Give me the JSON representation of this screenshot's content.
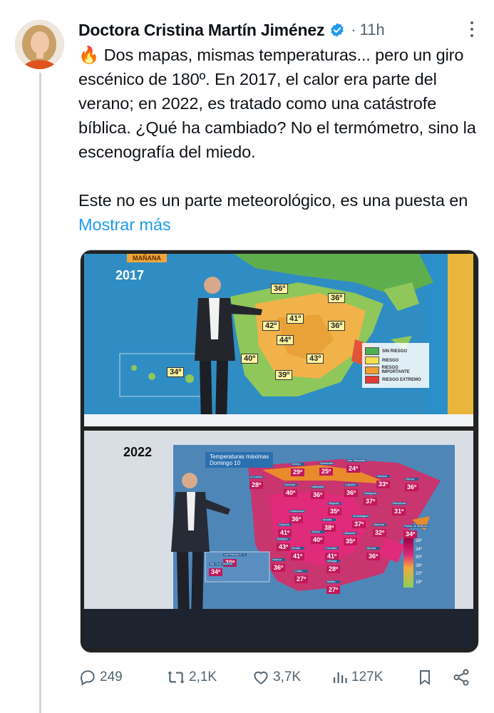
{
  "tweet": {
    "author_name": "Doctora Cristina Martín Jiménez",
    "separator": "·",
    "time": "11h",
    "emoji": "🔥",
    "text_paragraph_1": "Dos mapas, mismas temperaturas... pero un giro escénico de 180º. En 2017, el calor era parte del verano; en 2022, es tratado como una catástrofe bíblica. ¿Qué ha cambiado? No el termómetro, sino la escenografía del miedo.",
    "text_paragraph_2": "Este no es un parte meteorológico, es una puesta en",
    "show_more": "Mostrar más"
  },
  "media": {
    "top_panel": {
      "year": "2017",
      "corner_label": "MAÑANA",
      "temps": [
        "36º",
        "36º",
        "41º",
        "42º",
        "44º",
        "36º",
        "40º",
        "43º",
        "39º",
        "34º"
      ],
      "legend": [
        "SIN RIESGO",
        "RIESGO",
        "RIESGO IMPORTANTE",
        "RIESGO EXTREMO"
      ],
      "legend_colors": [
        "#4caf50",
        "#f4e04d",
        "#f0a030",
        "#e53935"
      ]
    },
    "bottom_panel": {
      "year": "2022",
      "title": "Temperaturas máximas",
      "subtitle": "Domingo 10",
      "cities": [
        {
          "name": "Oviedo",
          "temp": "29º"
        },
        {
          "name": "Santander",
          "temp": "25º"
        },
        {
          "name": "San Sebastián",
          "temp": "24º"
        },
        {
          "name": "A Coruña",
          "temp": "28º"
        },
        {
          "name": "Huesca",
          "temp": "33º"
        },
        {
          "name": "Girona",
          "temp": "36º"
        },
        {
          "name": "Ourense",
          "temp": "40º"
        },
        {
          "name": "Valladolid",
          "temp": "36º"
        },
        {
          "name": "Logroño",
          "temp": "36º"
        },
        {
          "name": "Zaragoza",
          "temp": "37º"
        },
        {
          "name": "Segovia",
          "temp": "35º"
        },
        {
          "name": "Barcelona",
          "temp": "31º"
        },
        {
          "name": "Salamanca",
          "temp": "36º"
        },
        {
          "name": "Madrid",
          "temp": "38º"
        },
        {
          "name": "Guadalajara",
          "temp": "37º"
        },
        {
          "name": "Cáceres",
          "temp": "41º"
        },
        {
          "name": "Valencia",
          "temp": "32º"
        },
        {
          "name": "Toledo",
          "temp": "40º"
        },
        {
          "name": "Albacete",
          "temp": "35º"
        },
        {
          "name": "Badajoz",
          "temp": "43º"
        },
        {
          "name": "Sevilla",
          "temp": "41º"
        },
        {
          "name": "Córdoba",
          "temp": "41º"
        },
        {
          "name": "Murcia",
          "temp": "36º"
        },
        {
          "name": "Huelva",
          "temp": "36º"
        },
        {
          "name": "Málaga",
          "temp": "28º"
        },
        {
          "name": "Cádiz",
          "temp": "27º"
        },
        {
          "name": "Melilla",
          "temp": "27º"
        },
        {
          "name": "Palma de Mallorca",
          "temp": "34º"
        },
        {
          "name": "Las Palmas G. C.",
          "temp": "30º"
        },
        {
          "name": "Sta. Cruz Tenerife",
          "temp": "34º"
        }
      ],
      "scale": [
        "38º",
        "34º",
        "30º",
        "26º",
        "22º",
        "18º"
      ]
    }
  },
  "actions": {
    "replies": "249",
    "reposts": "2,1K",
    "likes": "3,7K",
    "views": "127K"
  },
  "colors": {
    "accent": "#1d9bf0",
    "muted": "#536471",
    "verified": "#1d9bf0"
  }
}
